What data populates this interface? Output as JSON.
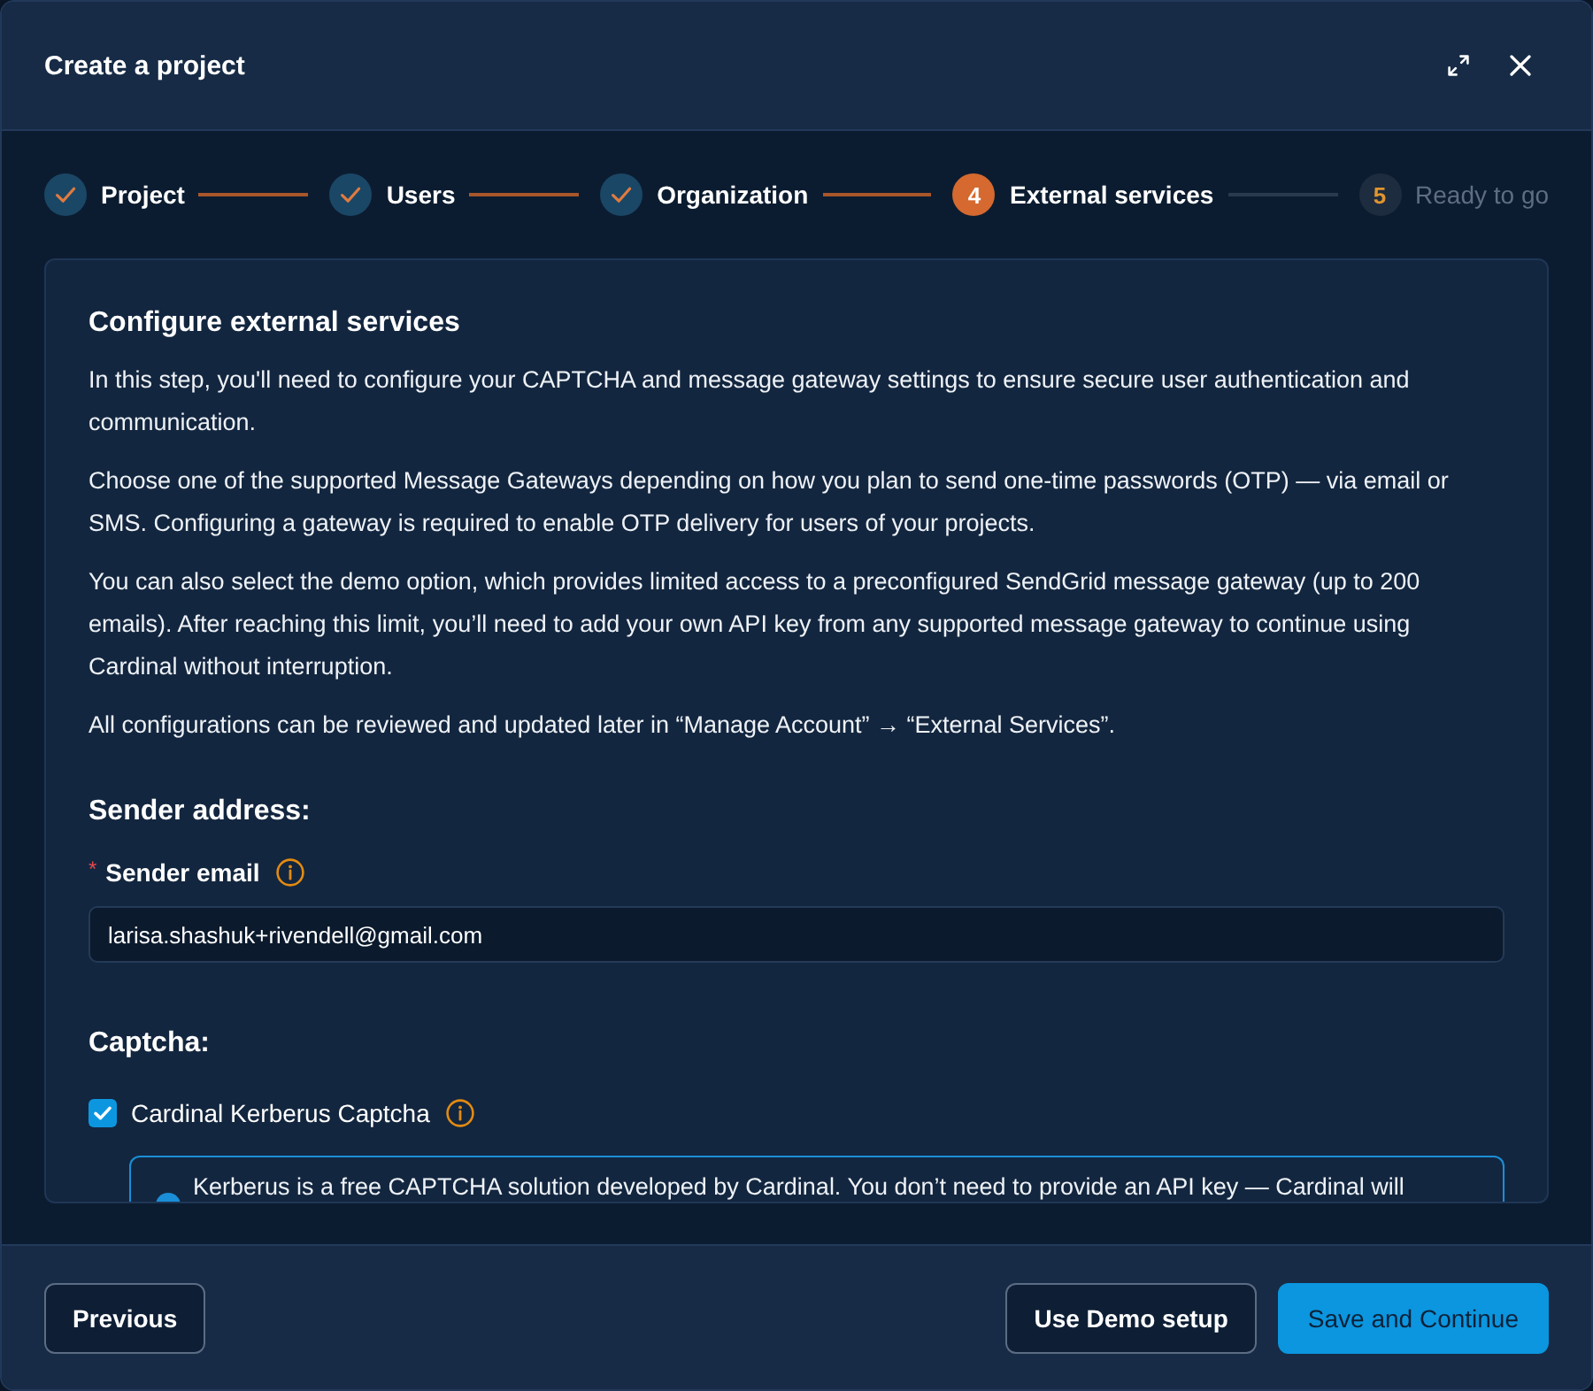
{
  "window": {
    "title": "Create a project"
  },
  "steps": [
    {
      "label": "Project",
      "completed": true,
      "current": false
    },
    {
      "label": "Users",
      "completed": true,
      "current": false
    },
    {
      "label": "Organization",
      "completed": true,
      "current": false
    },
    {
      "label": "External services",
      "completed": false,
      "current": true,
      "number": "4"
    },
    {
      "label": "Ready to go",
      "completed": false,
      "current": false,
      "number": "5"
    }
  ],
  "section": {
    "title": "Configure external services",
    "paragraphs": [
      "In this step, you'll need to configure your CAPTCHA and message gateway settings to ensure secure user authentication and communication.",
      "Choose one of the supported Message Gateways depending on how you plan to send one-time passwords (OTP) — via email or SMS. Configuring a gateway is required to enable OTP delivery for users of your projects.",
      "You can also select the demo option, which provides limited access to a preconfigured SendGrid message gateway (up to 200 emails). After reaching this limit, you’ll need to add your own API key from any supported message gateway to continue using Cardinal without interruption.",
      "All configurations can be reviewed and updated later in “Manage Account” → “External Services”."
    ]
  },
  "sender": {
    "heading": "Sender address:",
    "field": {
      "label": "Sender email",
      "required_mark": "*",
      "value": "larisa.shashuk+rivendell@gmail.com"
    }
  },
  "captcha": {
    "heading": "Captcha:",
    "options": [
      {
        "label": "Cardinal Kerberus Captcha",
        "checked": true,
        "note": "Kerberus is a free CAPTCHA solution developed by Cardinal. You don’t need to provide an API key — Cardinal will"
      }
    ]
  },
  "footer": {
    "left_buttons": [
      {
        "label": "Previous",
        "kind": "secondary"
      }
    ],
    "right_buttons": [
      {
        "label": "Use Demo setup",
        "kind": "secondary"
      },
      {
        "label": "Save and Continue",
        "kind": "primary"
      }
    ]
  }
}
